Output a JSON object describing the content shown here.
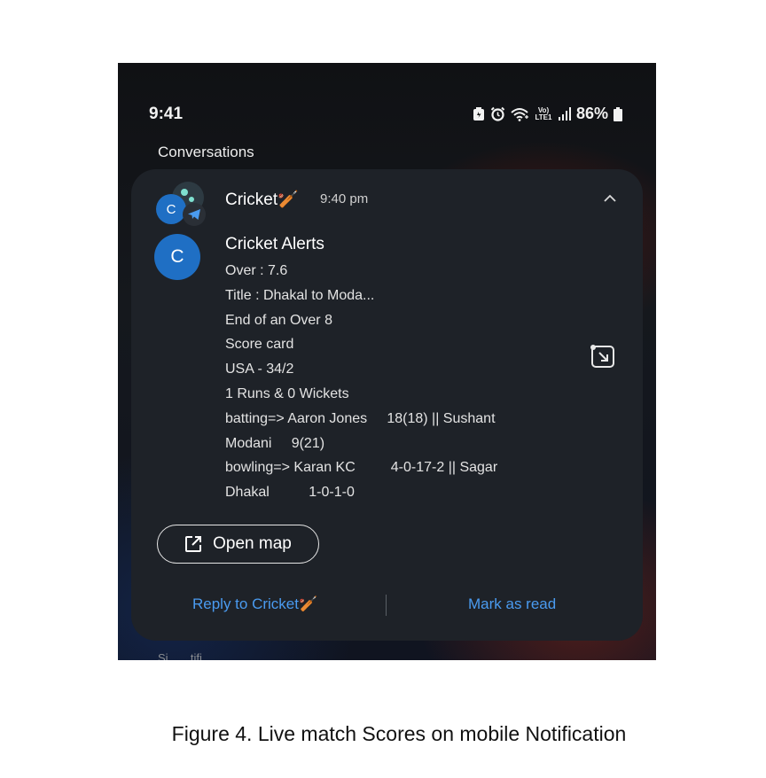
{
  "status_bar": {
    "time": "9:41",
    "network_label": "Vo) LTE1",
    "battery": "86%"
  },
  "section_title": "Conversations",
  "notification": {
    "app_name": "Cricket🏏",
    "timestamp": "9:40 pm",
    "avatar_letter": "C",
    "sender_initial": "C",
    "sender_name": "Cricket Alerts",
    "lines": [
      "Over : 7.6",
      "Title : Dhakal to Moda...",
      "End of an Over 8",
      "Score card",
      "USA - 34/2",
      "1 Runs & 0 Wickets",
      "batting=> Aaron Jones     18(18) || Sushant",
      "Modani     9(21)",
      "bowling=> Karan KC         4-0-17-2 || Sagar",
      "Dhakal          1-0-1-0"
    ],
    "open_map_label": "Open map",
    "reply_label": "Reply to Cricket🏏",
    "mark_read_label": "Mark as read"
  },
  "peek_text": "Si...  ...tifi...",
  "caption": "Figure 4. Live match Scores on mobile Notification",
  "colors": {
    "accent": "#4a9bf0",
    "avatar": "#1f6fc4",
    "card": "#1e2228"
  },
  "icons": [
    "battery-saver-icon",
    "alarm-icon",
    "wifi-icon",
    "signal-icon",
    "battery-icon",
    "telegram-icon",
    "chevron-up-icon",
    "expand-icon",
    "open-external-icon"
  ]
}
